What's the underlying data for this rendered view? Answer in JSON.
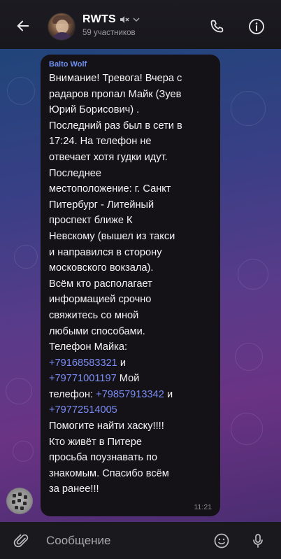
{
  "header": {
    "title": "RWTS",
    "subtitle": "59 участников",
    "icons": {
      "back": "arrow-left-icon",
      "mute": "speaker-muted-icon",
      "chevron": "chevron-down-icon",
      "call": "phone-icon",
      "info": "info-icon"
    }
  },
  "message": {
    "sender": "Balto Wolf",
    "time": "11:21",
    "lines": [
      "Внимание! Тревога! Вчера с",
      "радаров пропал Майк (Зуев",
      "Юрий Борисович) .",
      "Последний раз был в сети в",
      "17:24. На телефон не",
      "отвечает хотя гудки идут.",
      "Последнее",
      "местоположение: г. Санкт",
      "Питербург - Литейный",
      "проспект ближе К",
      "Невскому (вышел из такси",
      "и направился в сторону",
      "московского вокзала).",
      "Всём кто располагает",
      "информацией срочно",
      "свяжитесь со мной",
      "любыми способами.",
      "Телефон Майка:"
    ],
    "phone1": "+79168583321",
    "and1": " и",
    "phone2": "+79771001197",
    "my_phone_label": " Мой",
    "phone_label": "телефон: ",
    "phone3": "+79857913342",
    "and2": " и",
    "phone4": "+79772514005",
    "lines_end": [
      "Помогите найти хаску!!!!",
      "Кто живёт в Питере",
      "просьба поузнавать по",
      "знакомым. Спасибо всём",
      "за ранее!!!"
    ]
  },
  "input": {
    "placeholder": "Сообщение",
    "icons": {
      "attach": "paperclip-icon",
      "emoji": "emoji-icon",
      "mic": "microphone-icon"
    }
  },
  "colors": {
    "accent": "#6f8ff0",
    "link": "#7a8cf5",
    "bubble": "#141217",
    "header": "#1d1b22"
  }
}
